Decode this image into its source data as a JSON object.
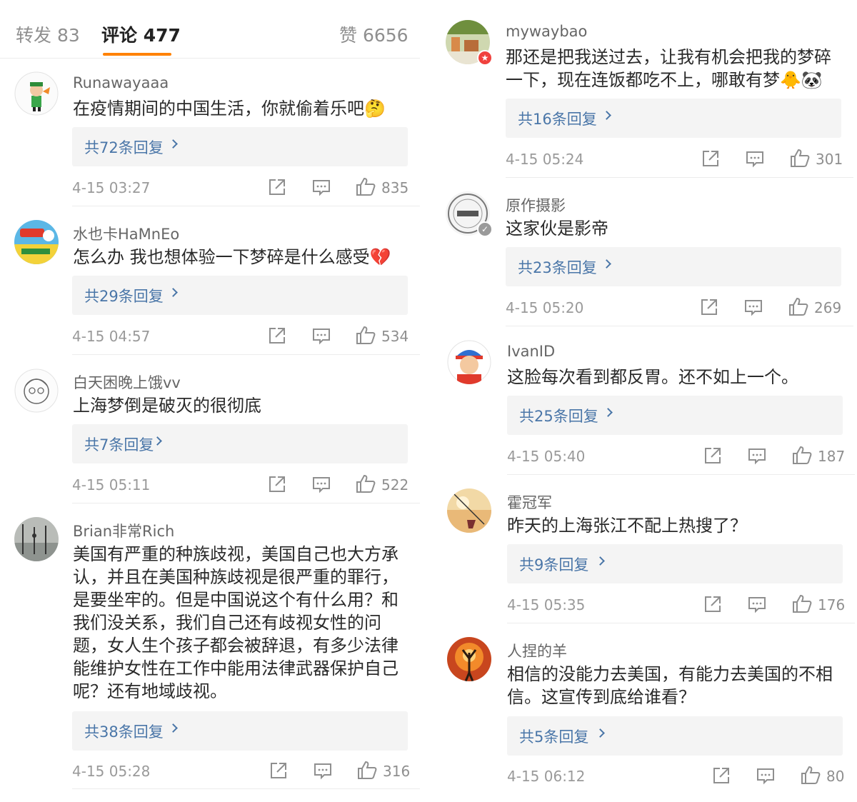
{
  "tabs": {
    "repost": "转发 83",
    "comments": "评论 477",
    "likes": "赞 6656"
  },
  "colors": {
    "accent": "#ff8200",
    "link": "#4a76a8",
    "reply_bg": "#f4f4f4"
  },
  "icons": [
    "share-icon",
    "comment-icon",
    "like-icon",
    "chevron-right-icon",
    "verified-badge-icon"
  ],
  "left_comments": [
    {
      "user": "Runawayaaa",
      "text": "在疫情期间的中国生活，你就偷着乐吧🤔",
      "replies": "共72条回复",
      "time": "4-15 03:27",
      "likes": "835"
    },
    {
      "user": "水也卡HaMnEo",
      "text": "怎么办 我也想体验一下梦碎是什么感受💔",
      "replies": "共29条回复",
      "time": "4-15 04:57",
      "likes": "534"
    },
    {
      "user": "白天困晚上饿vv",
      "text": "上海梦倒是破灭的很彻底",
      "replies": "共7条回复",
      "time": "4-15 05:11",
      "likes": "522"
    },
    {
      "user": "Brian非常Rich",
      "text": "美国有严重的种族歧视，美国自己也大方承认，并且在美国种族歧视是很严重的罪行，是要坐牢的。但是中国说这个有什么用？和我们没关系，我们自己还有歧视女性的问题，女人生个孩子都会被辞退，有多少法律能维护女性在工作中能用法律武器保护自己呢？还有地域歧视。",
      "replies": "共38条回复",
      "time": "4-15 05:28",
      "likes": "316"
    }
  ],
  "right_comments": [
    {
      "user": "mywaybao",
      "text": "那还是把我送过去，让我有机会把我的梦碎一下，现在连饭都吃不上，哪敢有梦🐥🐼",
      "replies": "共16条回复",
      "time": "4-15 05:24",
      "likes": "301"
    },
    {
      "user": "原作摄影",
      "text": "这家伙是影帝",
      "replies": "共23条回复",
      "time": "4-15 05:20",
      "likes": "269"
    },
    {
      "user": "IvanID",
      "text": "这脸每次看到都反胃。还不如上一个。",
      "replies": "共25条回复",
      "time": "4-15 05:40",
      "likes": "187"
    },
    {
      "user": "霍冠军",
      "text": "昨天的上海张江不配上热搜了？",
      "replies": "共9条回复",
      "time": "4-15 05:35",
      "likes": "176"
    },
    {
      "user": "人捏的羊",
      "text": "相信的没能力去美国，有能力去美国的不相信。这宣传到底给谁看？",
      "replies": "共5条回复",
      "time": "4-15 06:12",
      "likes": "80"
    }
  ]
}
